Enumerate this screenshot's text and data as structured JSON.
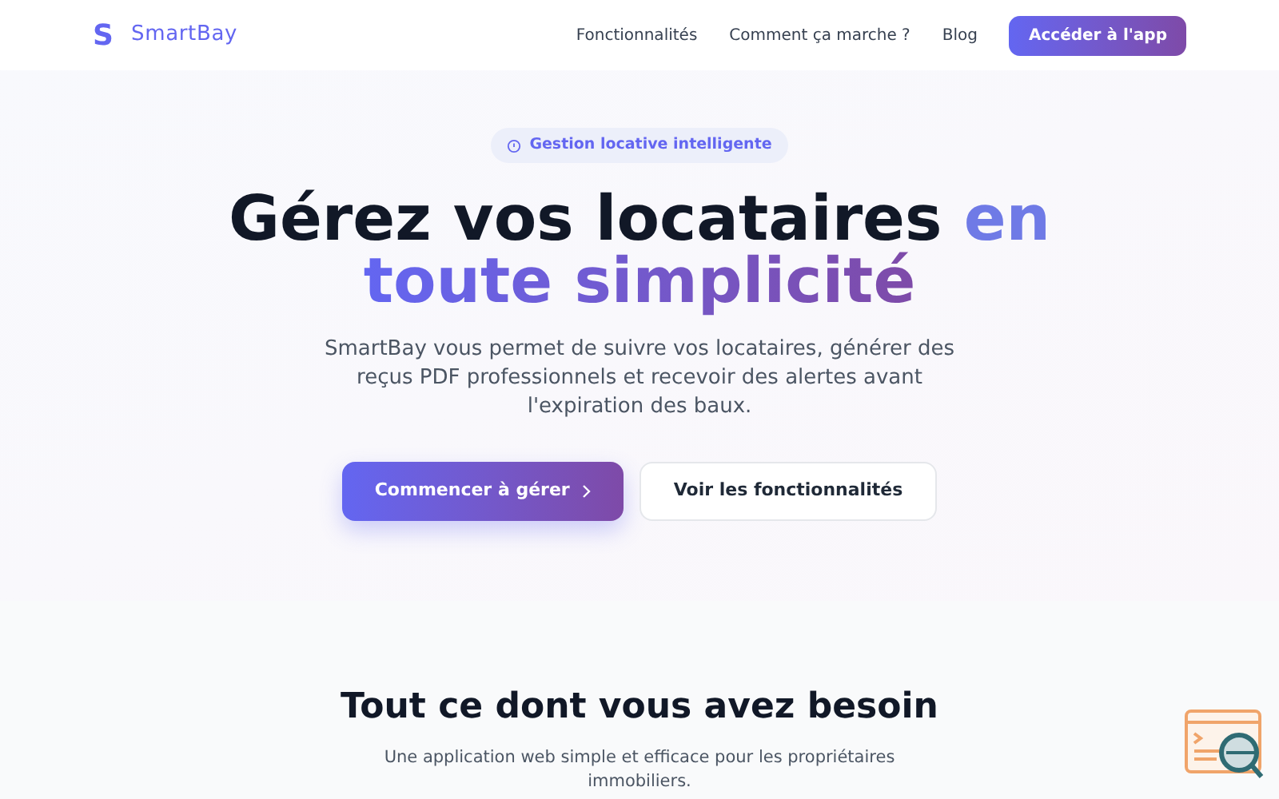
{
  "brand": {
    "logo_letter": "S",
    "name": "SmartBay"
  },
  "nav": {
    "links": [
      "Fonctionnalités",
      "Comment ça marche ?",
      "Blog"
    ],
    "cta": "Accéder à l'app"
  },
  "hero": {
    "badge": "Gestion locative intelligente",
    "title_dark": "Gérez vos locataires",
    "title_accent_1": "en",
    "title_accent_2": "toute simplicité",
    "description": "SmartBay vous permet de suivre vos locataires, générer des reçus PDF professionnels et recevoir des alertes avant l'expiration des baux.",
    "primary": "Commencer à gérer",
    "secondary": "Voir les fonctionnalités"
  },
  "features": {
    "title": "Tout ce dont vous avez besoin",
    "subtitle": "Une application web simple et efficace pour les propriétaires immobiliers."
  }
}
